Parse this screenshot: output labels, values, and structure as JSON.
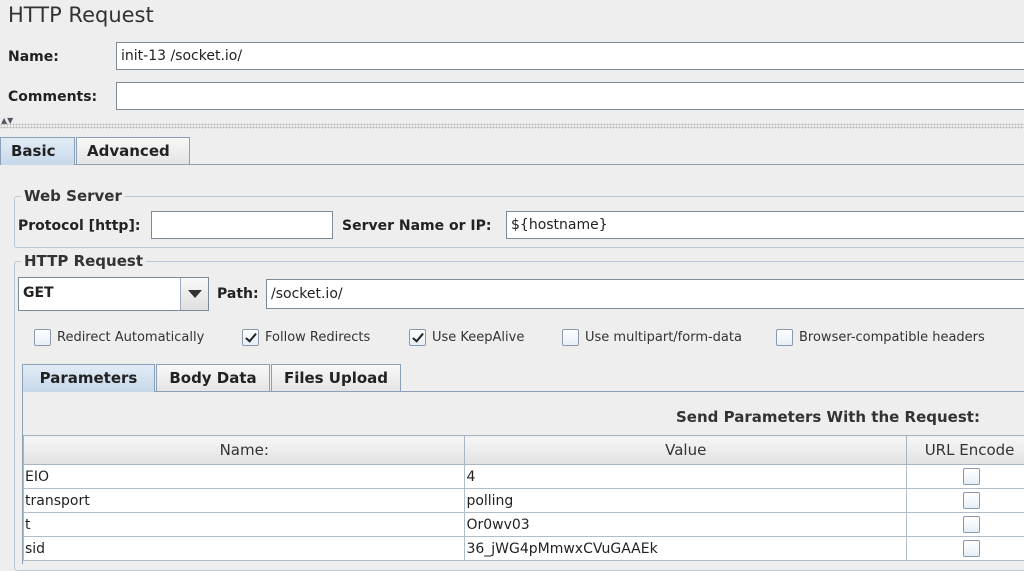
{
  "title": "HTTP Request",
  "name_label": "Name:",
  "name_value": "init-13 /socket.io/",
  "comments_label": "Comments:",
  "comments_value": "",
  "tabs": [
    {
      "label": "Basic",
      "selected": true
    },
    {
      "label": "Advanced",
      "selected": false
    }
  ],
  "web_server": {
    "group_title": "Web Server",
    "protocol_label": "Protocol [http]:",
    "protocol_value": "",
    "server_label": "Server Name or IP:",
    "server_value": "${hostname}"
  },
  "http_request": {
    "group_title": "HTTP Request",
    "method": "GET",
    "path_label": "Path:",
    "path_value": "/socket.io/",
    "options": [
      {
        "label": "Redirect Automatically",
        "checked": false
      },
      {
        "label": "Follow Redirects",
        "checked": true
      },
      {
        "label": "Use KeepAlive",
        "checked": true
      },
      {
        "label": "Use multipart/form-data",
        "checked": false
      },
      {
        "label": "Browser-compatible headers",
        "checked": false
      }
    ]
  },
  "sub_tabs": [
    {
      "label": "Parameters",
      "selected": true
    },
    {
      "label": "Body Data",
      "selected": false
    },
    {
      "label": "Files Upload",
      "selected": false
    }
  ],
  "params_table": {
    "caption": "Send Parameters With the Request:",
    "columns": [
      "Name:",
      "Value",
      "URL Encode"
    ],
    "rows": [
      {
        "name": "EIO",
        "value": "4",
        "encode": false
      },
      {
        "name": "transport",
        "value": "polling",
        "encode": false
      },
      {
        "name": "t",
        "value": "Or0wv03",
        "encode": false
      },
      {
        "name": "sid",
        "value": "36_jWG4pMmwxCVuGAAEk",
        "encode": false
      }
    ]
  }
}
